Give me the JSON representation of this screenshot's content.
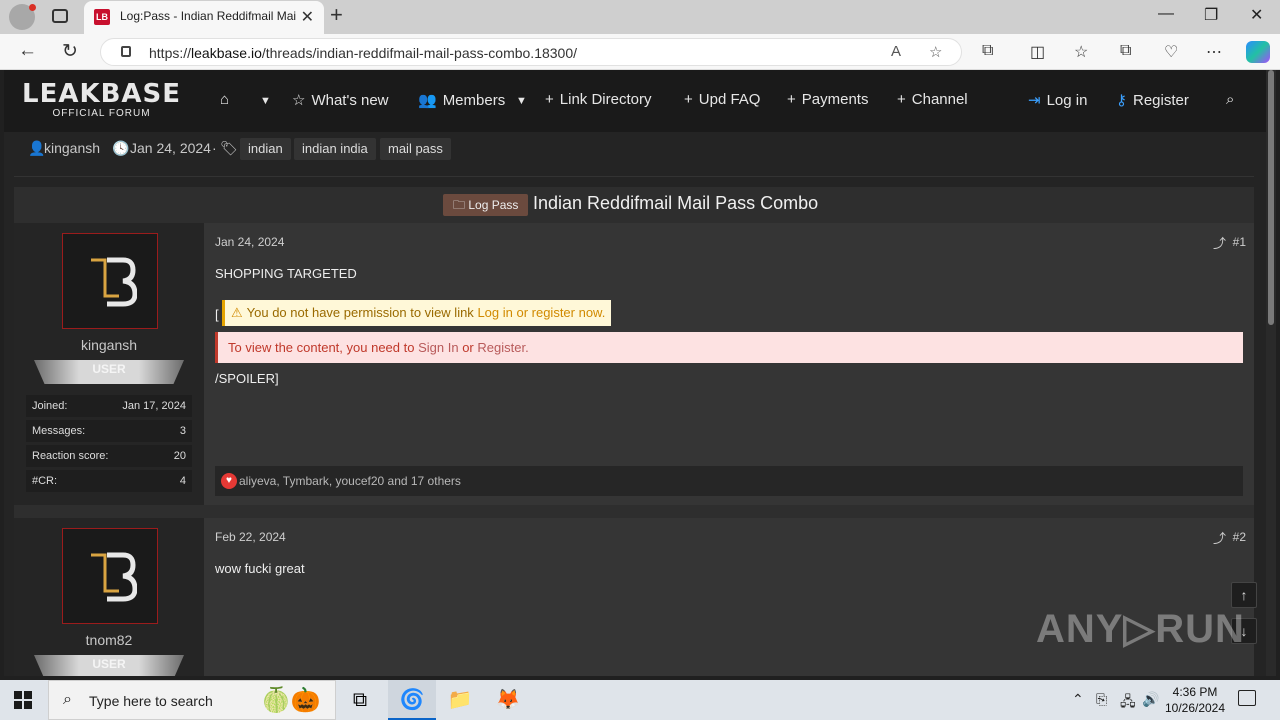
{
  "browser": {
    "tab_title": "Log:Pass - Indian Reddifmail Mai",
    "url_prefix": "https://",
    "url_domain": "leakbase.io",
    "url_path": "/threads/indian-reddifmail-mail-pass-combo.18300/"
  },
  "site": {
    "logo_main": "LEAKBASE",
    "logo_sub": "OFFICIAL FORUM",
    "nav": {
      "whats_new": "What's new",
      "members": "Members",
      "link_directory": "Link Directory",
      "upd_faq": "Upd FAQ",
      "payments": "Payments",
      "channel": "Channel",
      "login": "Log in",
      "register": "Register"
    }
  },
  "thread": {
    "author": "kingansh",
    "date": "Jan 24, 2024",
    "tags": [
      "indian",
      "indian india",
      "mail pass"
    ],
    "prefix": "Log Pass",
    "title": "Indian Reddifmail Mail Pass Combo"
  },
  "posts": [
    {
      "username": "kingansh",
      "role": "USER",
      "stats": [
        {
          "k": "Joined:",
          "v": "Jan 17, 2024"
        },
        {
          "k": "Messages:",
          "v": "3"
        },
        {
          "k": "Reaction score:",
          "v": "20"
        },
        {
          "k": "#CR:",
          "v": "4"
        }
      ],
      "date": "Jan 24, 2024",
      "num": "#1",
      "line1": "SHOPPING TARGETED",
      "bracket": "[",
      "perm_prefix": "You do not have permission to view link",
      "perm_link": "Log in or register now.",
      "signin_prefix": "To view the content, you need to",
      "signin_link1": "Sign In",
      "signin_or": "or",
      "signin_link2": "Register.",
      "spoiler_end": "/SPOILER]",
      "reactions": "aliyeva, Tymbark, youcef20 and 17 others"
    },
    {
      "username": "tnom82",
      "role": "USER",
      "date": "Feb 22, 2024",
      "num": "#2",
      "text": "wow fucki great"
    }
  ],
  "watermark": "ANY▷RUN",
  "taskbar": {
    "search_placeholder": "Type here to search",
    "time": "4:36 PM",
    "date": "10/26/2024"
  }
}
